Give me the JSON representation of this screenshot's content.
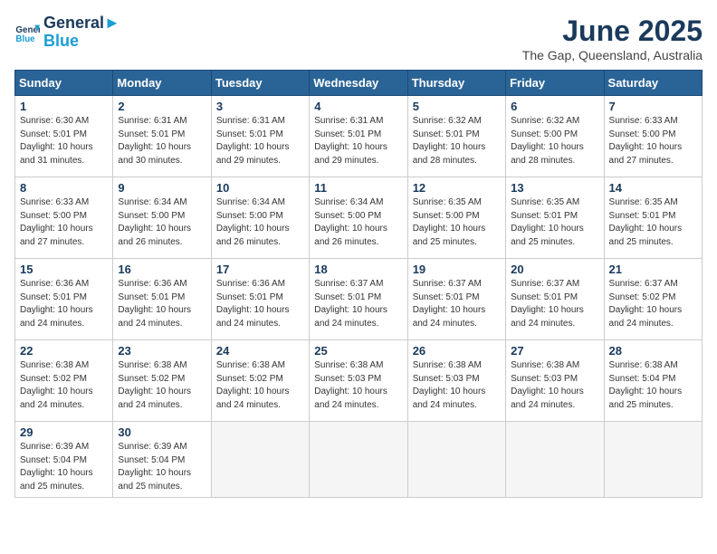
{
  "logo": {
    "line1": "General",
    "line2": "Blue"
  },
  "title": "June 2025",
  "location": "The Gap, Queensland, Australia",
  "days_of_week": [
    "Sunday",
    "Monday",
    "Tuesday",
    "Wednesday",
    "Thursday",
    "Friday",
    "Saturday"
  ],
  "weeks": [
    [
      {
        "num": "1",
        "sunrise": "6:30 AM",
        "sunset": "5:01 PM",
        "daylight": "10 hours and 31 minutes."
      },
      {
        "num": "2",
        "sunrise": "6:31 AM",
        "sunset": "5:01 PM",
        "daylight": "10 hours and 30 minutes."
      },
      {
        "num": "3",
        "sunrise": "6:31 AM",
        "sunset": "5:01 PM",
        "daylight": "10 hours and 29 minutes."
      },
      {
        "num": "4",
        "sunrise": "6:31 AM",
        "sunset": "5:01 PM",
        "daylight": "10 hours and 29 minutes."
      },
      {
        "num": "5",
        "sunrise": "6:32 AM",
        "sunset": "5:01 PM",
        "daylight": "10 hours and 28 minutes."
      },
      {
        "num": "6",
        "sunrise": "6:32 AM",
        "sunset": "5:00 PM",
        "daylight": "10 hours and 28 minutes."
      },
      {
        "num": "7",
        "sunrise": "6:33 AM",
        "sunset": "5:00 PM",
        "daylight": "10 hours and 27 minutes."
      }
    ],
    [
      {
        "num": "8",
        "sunrise": "6:33 AM",
        "sunset": "5:00 PM",
        "daylight": "10 hours and 27 minutes."
      },
      {
        "num": "9",
        "sunrise": "6:34 AM",
        "sunset": "5:00 PM",
        "daylight": "10 hours and 26 minutes."
      },
      {
        "num": "10",
        "sunrise": "6:34 AM",
        "sunset": "5:00 PM",
        "daylight": "10 hours and 26 minutes."
      },
      {
        "num": "11",
        "sunrise": "6:34 AM",
        "sunset": "5:00 PM",
        "daylight": "10 hours and 26 minutes."
      },
      {
        "num": "12",
        "sunrise": "6:35 AM",
        "sunset": "5:00 PM",
        "daylight": "10 hours and 25 minutes."
      },
      {
        "num": "13",
        "sunrise": "6:35 AM",
        "sunset": "5:01 PM",
        "daylight": "10 hours and 25 minutes."
      },
      {
        "num": "14",
        "sunrise": "6:35 AM",
        "sunset": "5:01 PM",
        "daylight": "10 hours and 25 minutes."
      }
    ],
    [
      {
        "num": "15",
        "sunrise": "6:36 AM",
        "sunset": "5:01 PM",
        "daylight": "10 hours and 24 minutes."
      },
      {
        "num": "16",
        "sunrise": "6:36 AM",
        "sunset": "5:01 PM",
        "daylight": "10 hours and 24 minutes."
      },
      {
        "num": "17",
        "sunrise": "6:36 AM",
        "sunset": "5:01 PM",
        "daylight": "10 hours and 24 minutes."
      },
      {
        "num": "18",
        "sunrise": "6:37 AM",
        "sunset": "5:01 PM",
        "daylight": "10 hours and 24 minutes."
      },
      {
        "num": "19",
        "sunrise": "6:37 AM",
        "sunset": "5:01 PM",
        "daylight": "10 hours and 24 minutes."
      },
      {
        "num": "20",
        "sunrise": "6:37 AM",
        "sunset": "5:01 PM",
        "daylight": "10 hours and 24 minutes."
      },
      {
        "num": "21",
        "sunrise": "6:37 AM",
        "sunset": "5:02 PM",
        "daylight": "10 hours and 24 minutes."
      }
    ],
    [
      {
        "num": "22",
        "sunrise": "6:38 AM",
        "sunset": "5:02 PM",
        "daylight": "10 hours and 24 minutes."
      },
      {
        "num": "23",
        "sunrise": "6:38 AM",
        "sunset": "5:02 PM",
        "daylight": "10 hours and 24 minutes."
      },
      {
        "num": "24",
        "sunrise": "6:38 AM",
        "sunset": "5:02 PM",
        "daylight": "10 hours and 24 minutes."
      },
      {
        "num": "25",
        "sunrise": "6:38 AM",
        "sunset": "5:03 PM",
        "daylight": "10 hours and 24 minutes."
      },
      {
        "num": "26",
        "sunrise": "6:38 AM",
        "sunset": "5:03 PM",
        "daylight": "10 hours and 24 minutes."
      },
      {
        "num": "27",
        "sunrise": "6:38 AM",
        "sunset": "5:03 PM",
        "daylight": "10 hours and 24 minutes."
      },
      {
        "num": "28",
        "sunrise": "6:38 AM",
        "sunset": "5:04 PM",
        "daylight": "10 hours and 25 minutes."
      }
    ],
    [
      {
        "num": "29",
        "sunrise": "6:39 AM",
        "sunset": "5:04 PM",
        "daylight": "10 hours and 25 minutes."
      },
      {
        "num": "30",
        "sunrise": "6:39 AM",
        "sunset": "5:04 PM",
        "daylight": "10 hours and 25 minutes."
      },
      null,
      null,
      null,
      null,
      null
    ]
  ]
}
